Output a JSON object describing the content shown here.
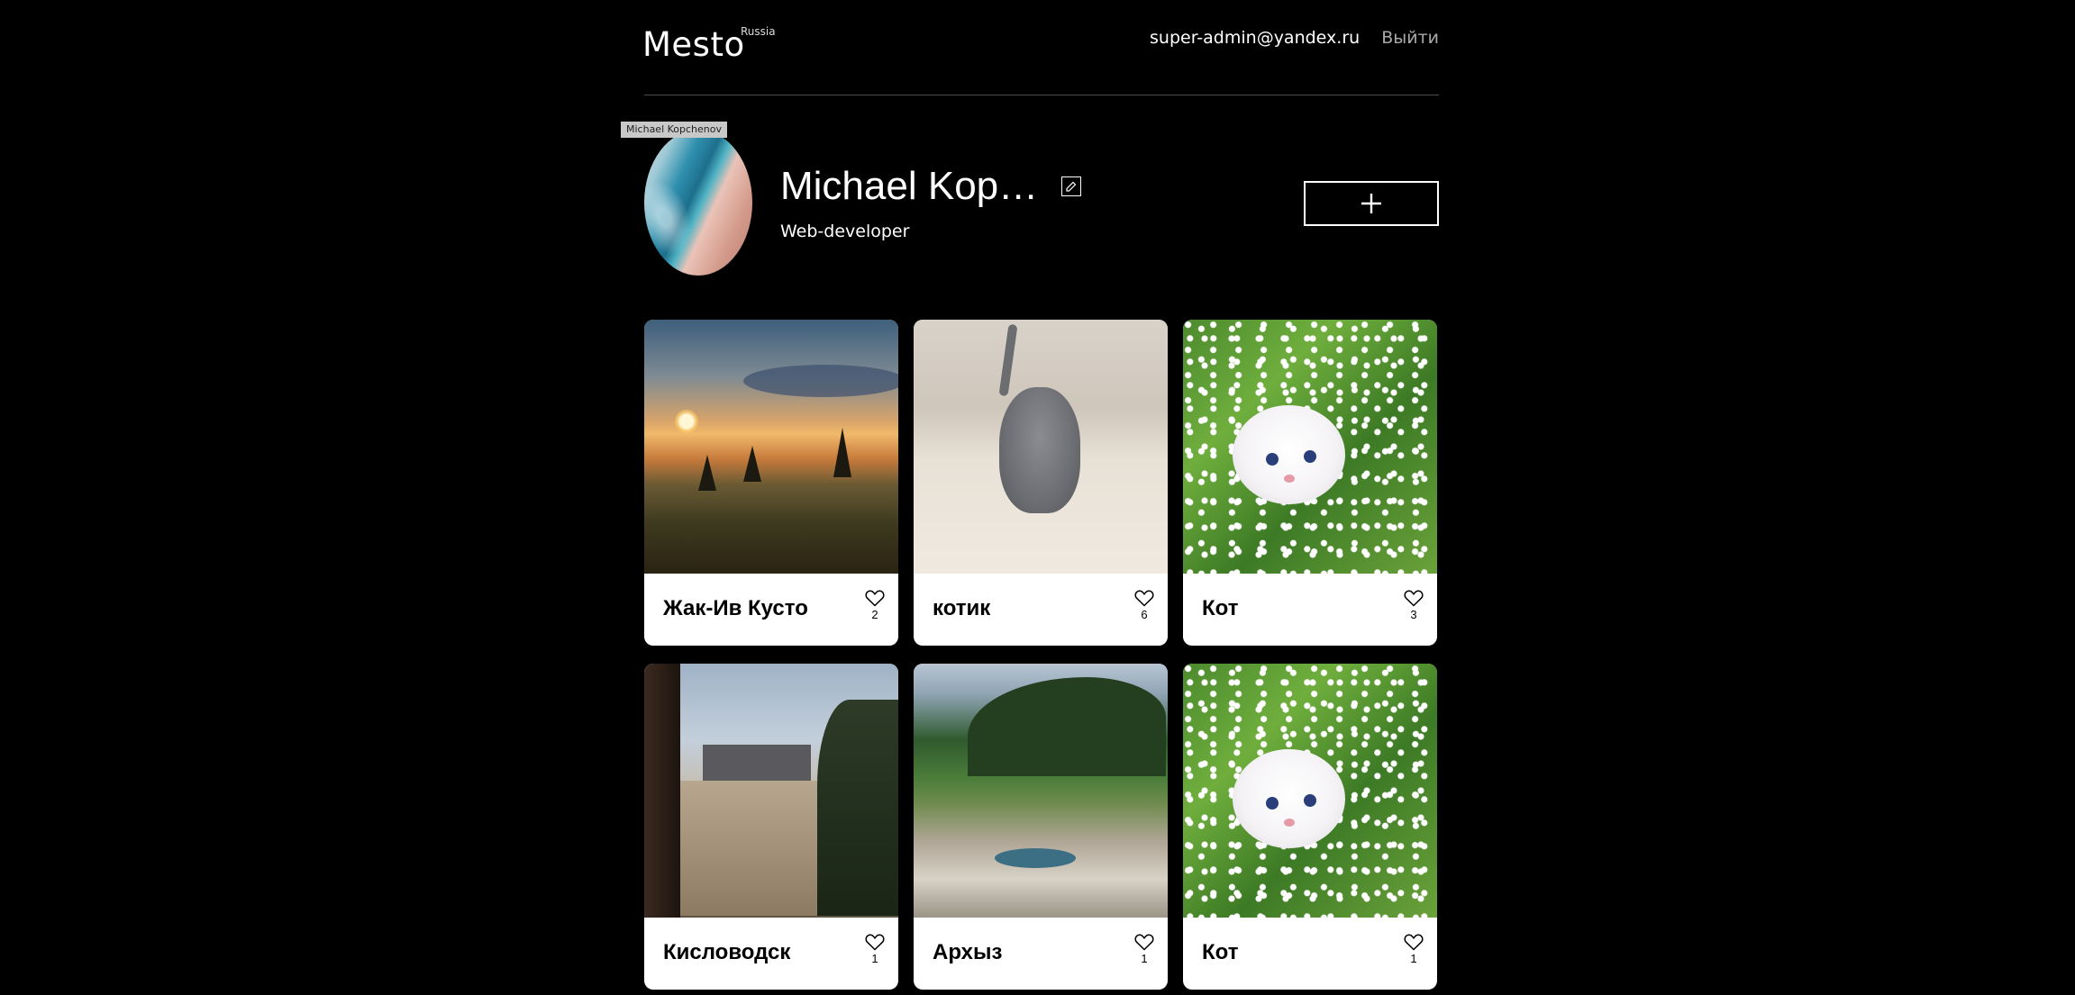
{
  "header": {
    "logo": "Mesto",
    "logo_sup": "Russia",
    "email": "super-admin@yandex.ru",
    "logout": "Выйти"
  },
  "profile": {
    "avatar_tooltip": "Michael Kopchenov",
    "name": "Michael Kopchenov",
    "about": "Web-developer"
  },
  "icons": {
    "edit": "pencil-icon",
    "add": "plus-icon",
    "like": "heart-icon"
  },
  "cards": [
    {
      "title": "Жак-Ив Кусто",
      "likes": "2",
      "image": "sunset-landscape"
    },
    {
      "title": "котик",
      "likes": "6",
      "image": "grey-kitten"
    },
    {
      "title": "Кот",
      "likes": "3",
      "image": "white-kitten-in-flowers"
    },
    {
      "title": "Кисловодск",
      "likes": "1",
      "image": "kislovodsk-building"
    },
    {
      "title": "Архыз",
      "likes": "1",
      "image": "arkhyz-mountains"
    },
    {
      "title": "Кот",
      "likes": "1",
      "image": "white-kitten-in-flowers"
    }
  ]
}
